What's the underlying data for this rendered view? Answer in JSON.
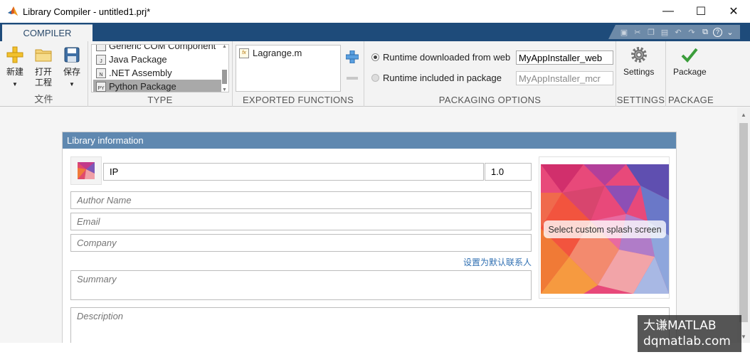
{
  "window": {
    "title": "Library Compiler - untitled1.prj*",
    "minimize": "—",
    "maximize": "☐",
    "close": "✕"
  },
  "tabs": {
    "compiler": "COMPILER"
  },
  "file_section": {
    "label": "文件",
    "new_label": "新建",
    "open_label_1": "打开",
    "open_label_2": "工程",
    "save_label": "保存"
  },
  "type_section": {
    "label": "TYPE",
    "items": [
      {
        "label": "Generic COM Component",
        "icon": "com-icon"
      },
      {
        "label": "Java Package",
        "icon": "java-icon"
      },
      {
        "label": ".NET Assembly",
        "icon": "net-icon"
      },
      {
        "label": "Python Package",
        "icon": "python-icon",
        "selected": true
      }
    ]
  },
  "exported_functions": {
    "label": "EXPORTED FUNCTIONS",
    "items": [
      {
        "label": "Lagrange.m",
        "icon": "function-file-icon"
      }
    ]
  },
  "packaging_options": {
    "label": "PACKAGING OPTIONS",
    "runtime_web_label": "Runtime downloaded from web",
    "runtime_web_value": "MyAppInstaller_web",
    "runtime_pkg_label": "Runtime included in package",
    "runtime_pkg_value": "MyAppInstaller_mcr"
  },
  "settings": {
    "label": "SETTINGS",
    "button": "Settings"
  },
  "package": {
    "label": "PACKAGE",
    "button": "Package"
  },
  "library_info": {
    "header": "Library information",
    "name_value": "IP",
    "version_value": "1.0",
    "author_placeholder": "Author Name",
    "email_placeholder": "Email",
    "company_placeholder": "Company",
    "set_default_contact": "设置为默认联系人",
    "summary_placeholder": "Summary",
    "description_placeholder": "Description",
    "splash_label": "Select custom splash screen"
  },
  "watermark": {
    "line1": "大谦MATLAB",
    "line2": "dqmatlab.com"
  },
  "colors": {
    "toolstrip": "#1e4b7a",
    "panel_header": "#5f88b0",
    "link": "#2f6fb2"
  }
}
